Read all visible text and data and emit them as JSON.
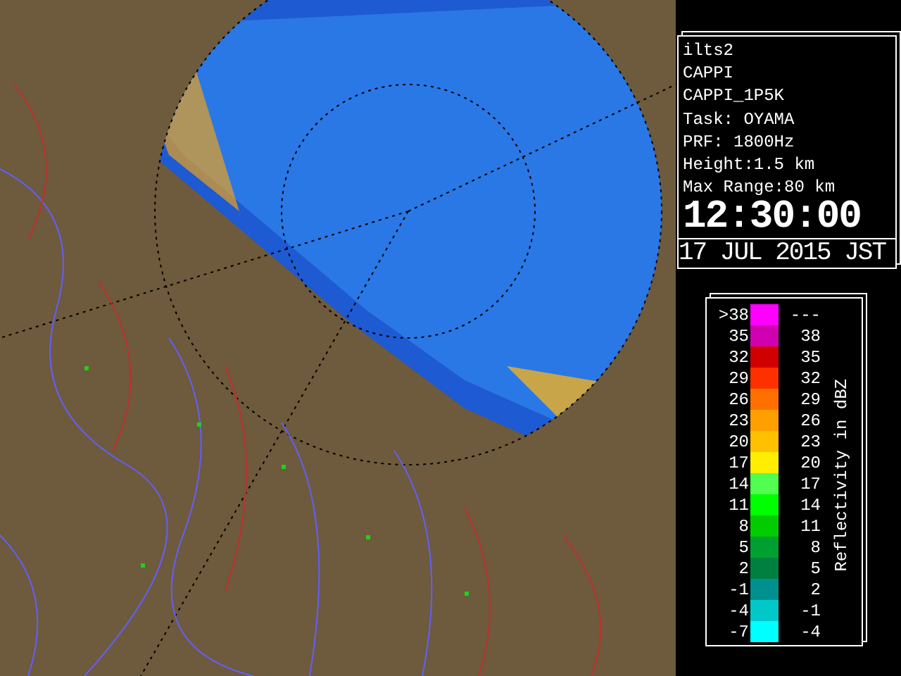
{
  "info": {
    "station": "ilts2",
    "product": "CAPPI",
    "product_id": "CAPPI_1P5K",
    "task": "Task: OYAMA",
    "prf": "PRF: 1800Hz",
    "height": "Height:1.5 km",
    "max_range": "Max Range:80 km",
    "time": "12:30:00",
    "date": "17 JUL 2015 JST"
  },
  "legend": {
    "title": "Reflectivity in dBZ",
    "rows": [
      {
        "low": ">38",
        "high": "---",
        "color": "#ff00ff"
      },
      {
        "low": "35",
        "high": "38",
        "color": "#d000b0"
      },
      {
        "low": "32",
        "high": "35",
        "color": "#d00000"
      },
      {
        "low": "29",
        "high": "32",
        "color": "#ff3000"
      },
      {
        "low": "26",
        "high": "29",
        "color": "#ff7000"
      },
      {
        "low": "23",
        "high": "26",
        "color": "#ffa000"
      },
      {
        "low": "20",
        "high": "23",
        "color": "#ffc000"
      },
      {
        "low": "17",
        "high": "20",
        "color": "#ffee00"
      },
      {
        "low": "14",
        "high": "17",
        "color": "#50ff50"
      },
      {
        "low": "11",
        "high": "14",
        "color": "#00ff00"
      },
      {
        "low": "8",
        "high": "11",
        "color": "#00cc00"
      },
      {
        "low": "5",
        "high": "8",
        "color": "#00a030"
      },
      {
        "low": "2",
        "high": "5",
        "color": "#008040"
      },
      {
        "low": "-1",
        "high": "2",
        "color": "#009090"
      },
      {
        "low": "-4",
        "high": "-1",
        "color": "#00c8c8"
      },
      {
        "low": "-7",
        "high": "-4",
        "color": "#00ffff"
      }
    ]
  }
}
